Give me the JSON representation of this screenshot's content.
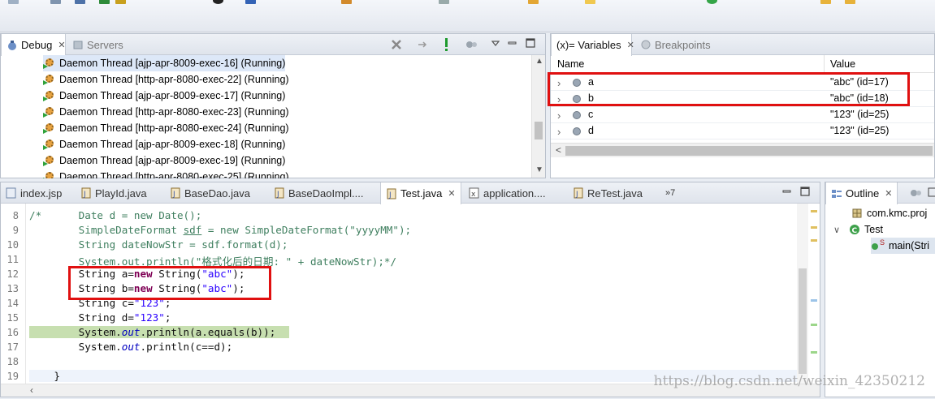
{
  "debug_view": {
    "tabs": [
      {
        "label": "Debug",
        "icon": "debug-icon",
        "close": "✕"
      },
      {
        "label": "Servers",
        "icon": "servers-icon"
      }
    ],
    "threads": [
      "Daemon Thread [ajp-apr-8009-exec-16] (Running)",
      "Daemon Thread [http-apr-8080-exec-22] (Running)",
      "Daemon Thread [ajp-apr-8009-exec-17] (Running)",
      "Daemon Thread [http-apr-8080-exec-23] (Running)",
      "Daemon Thread [http-apr-8080-exec-24] (Running)",
      "Daemon Thread [ajp-apr-8009-exec-18] (Running)",
      "Daemon Thread [ajp-apr-8009-exec-19] (Running)",
      "Daemon Thread [http-apr-8080-exec-25] (Running)"
    ]
  },
  "variables_view": {
    "tabs": [
      {
        "label": "(x)= Variables",
        "close": "✕"
      },
      {
        "label": "Breakpoints",
        "icon": "breakpoints-icon"
      }
    ],
    "columns": {
      "name": "Name",
      "value": "Value"
    },
    "rows": [
      {
        "name": "a",
        "value": "\"abc\" (id=17)"
      },
      {
        "name": "b",
        "value": "\"abc\" (id=18)"
      },
      {
        "name": "c",
        "value": "\"123\" (id=25)"
      },
      {
        "name": "d",
        "value": "\"123\" (id=25)"
      }
    ],
    "scroll_left": "<"
  },
  "editor": {
    "tabs": [
      {
        "label": "index.jsp"
      },
      {
        "label": "PlayId.java"
      },
      {
        "label": "BaseDao.java"
      },
      {
        "label": "BaseDaoImpl...."
      },
      {
        "label": "Test.java",
        "active": true,
        "close": "✕"
      },
      {
        "label": "application...."
      },
      {
        "label": "ReTest.java"
      },
      {
        "label": "»7"
      }
    ],
    "lines": [
      {
        "n": "8",
        "code": "/*      Date d = new Date();"
      },
      {
        "n": "9",
        "code": "        SimpleDateFormat sdf = new SimpleDateFormat(\"yyyyMM\");"
      },
      {
        "n": "10",
        "code": "        String dateNowStr = sdf.format(d);"
      },
      {
        "n": "11",
        "code": "        System.out.println(\"格式化后的日期: \" + dateNowStr);*/"
      },
      {
        "n": "12",
        "code": "        String a=new String(\"abc\");"
      },
      {
        "n": "13",
        "code": "        String b=new String(\"abc\");"
      },
      {
        "n": "14",
        "code": "        String c=\"123\";"
      },
      {
        "n": "15",
        "code": "        String d=\"123\";"
      },
      {
        "n": "16",
        "code": "        System.out.println(a.equals(b));"
      },
      {
        "n": "17",
        "code": "        System.out.println(c==d);"
      },
      {
        "n": "18",
        "code": ""
      },
      {
        "n": "19",
        "code": "    }"
      }
    ]
  },
  "outline_view": {
    "tab": {
      "label": "Outline",
      "close": "✕"
    },
    "items": [
      {
        "label": "com.kmc.proj",
        "icon": "package-icon"
      },
      {
        "label": "Test",
        "icon": "class-icon",
        "twisty": "∨"
      },
      {
        "label": "main(Stri",
        "icon": "method-icon",
        "marker": "S"
      }
    ]
  },
  "watermark": "https://blog.csdn.net/weixin_42350212",
  "colors": {
    "highlight_box": "#e01010",
    "current_line": "#c7dfb0",
    "comment": "#3f7f5f",
    "keyword": "#7f0055",
    "string": "#2a00ff"
  }
}
